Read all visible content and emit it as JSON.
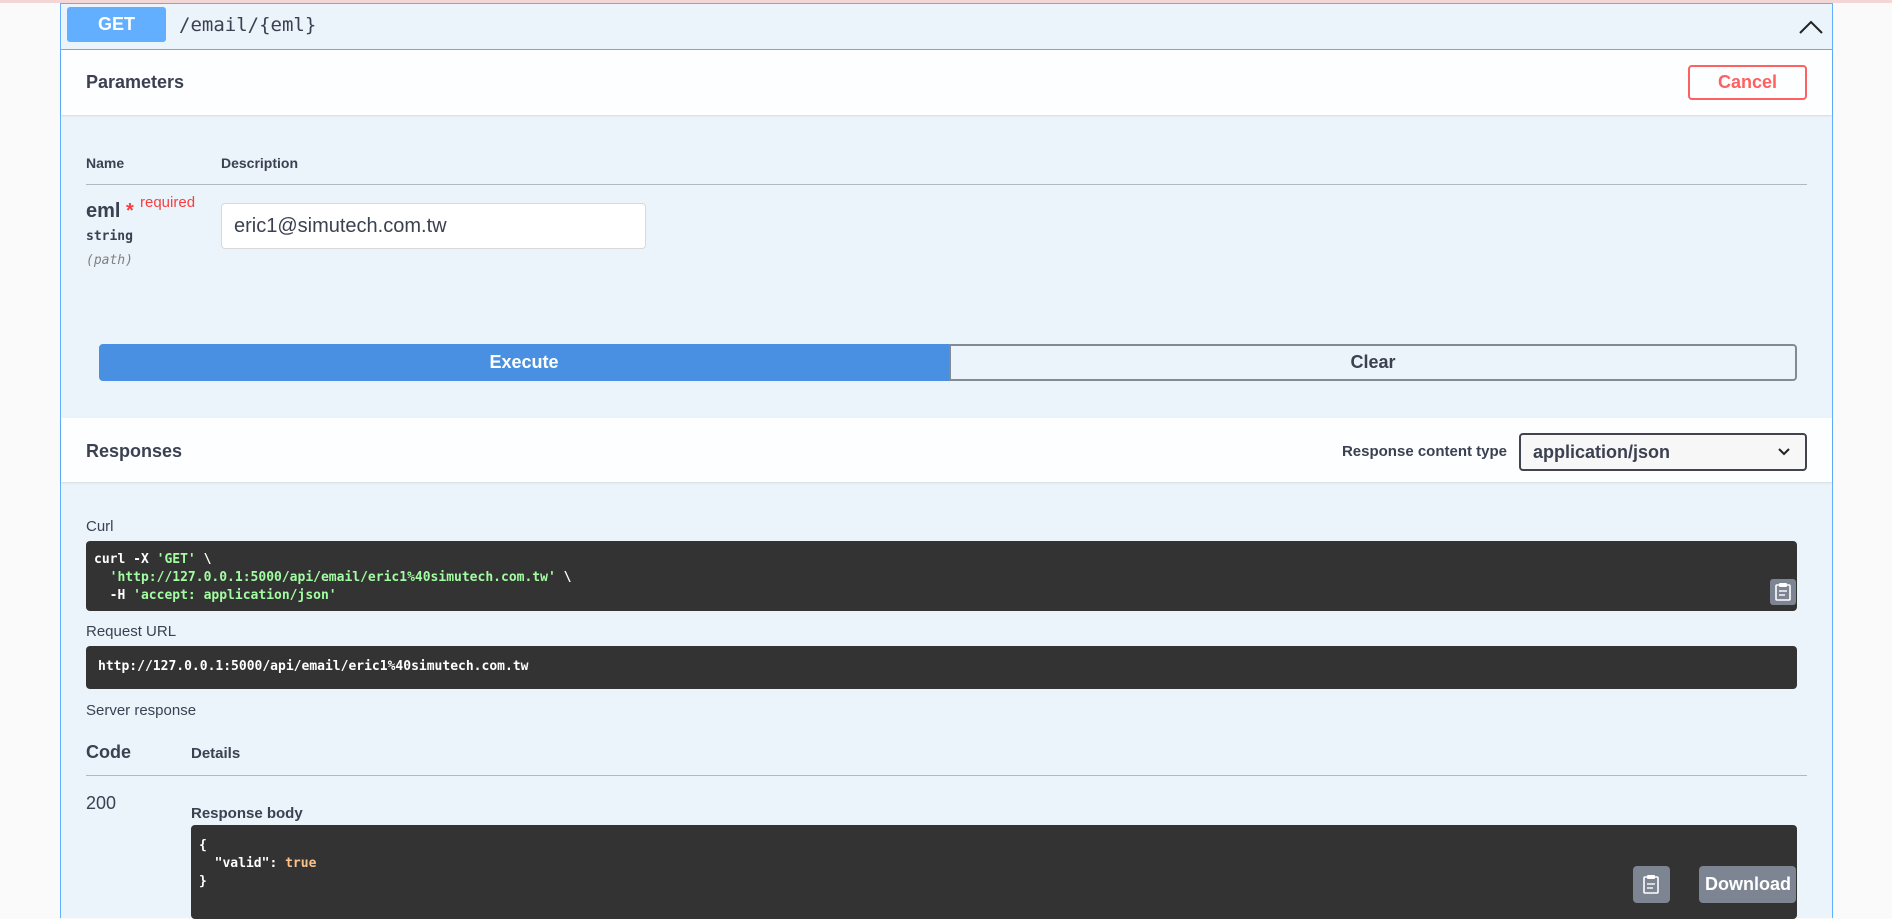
{
  "operation": {
    "method": "GET",
    "path": "/email/{eml}"
  },
  "parameters": {
    "title": "Parameters",
    "cancel_label": "Cancel",
    "col_name": "Name",
    "col_description": "Description",
    "items": [
      {
        "name": "eml",
        "required_star": "*",
        "required_label": "required",
        "type": "string",
        "in": "(path)",
        "value": "eric1@simutech.com.tw"
      }
    ]
  },
  "actions": {
    "execute_label": "Execute",
    "clear_label": "Clear"
  },
  "responses": {
    "title": "Responses",
    "content_type_label": "Response content type",
    "content_type_value": "application/json",
    "curl_label": "Curl",
    "curl": {
      "line1_cmd": "curl -X ",
      "line1_method": "'GET'",
      "line1_end": " \\",
      "line2_url": "'http://127.0.0.1:5000/api/email/eric1%40simutech.com.tw'",
      "line2_end": " \\",
      "line3_flag": "  -H ",
      "line3_header": "'accept: application/json'"
    },
    "request_url_label": "Request URL",
    "request_url": "http://127.0.0.1:5000/api/email/eric1%40simutech.com.tw",
    "server_response_label": "Server response",
    "col_code": "Code",
    "col_details": "Details",
    "status_code": "200",
    "response_body_label": "Response body",
    "body": {
      "open": "{",
      "key": "  \"valid\": ",
      "value": "true",
      "close": "}"
    },
    "download_label": "Download"
  },
  "colors": {
    "get_accent": "#61affe",
    "execute_blue": "#4990e2",
    "cancel_red": "#ff6060",
    "code_bg": "#333333"
  },
  "icons": [
    "chevron-up-icon",
    "chevron-down-icon",
    "copy-icon"
  ]
}
